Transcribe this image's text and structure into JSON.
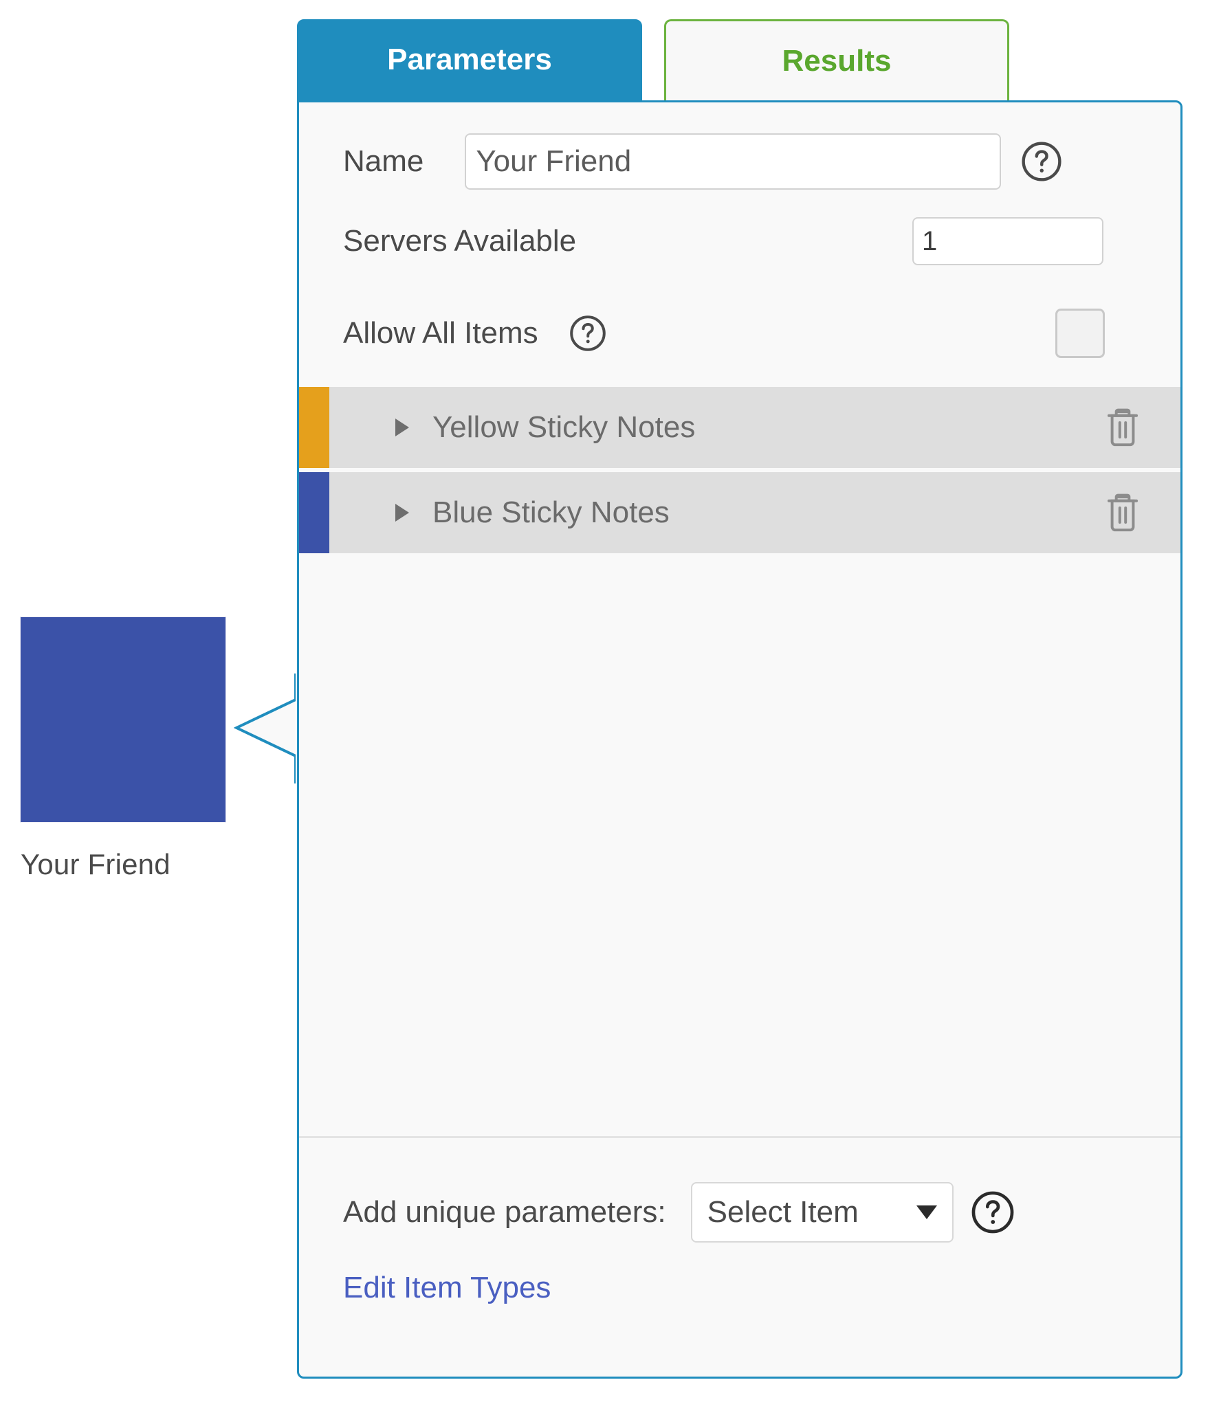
{
  "canvas": {
    "node": {
      "label": "Your Friend",
      "color": "#3b52a8"
    }
  },
  "tabs": [
    {
      "label": "Parameters",
      "active": true,
      "color": "#1f8dbe"
    },
    {
      "label": "Results",
      "active": false,
      "color": "#6cb33f"
    }
  ],
  "panel": {
    "border_color": "#1f8dbe",
    "fields": {
      "name": {
        "label": "Name",
        "value": "Your Friend",
        "placeholder": "Name",
        "help": "?"
      },
      "servers_available": {
        "label": "Servers Available",
        "value": "1",
        "placeholder": ""
      },
      "allow_all_items": {
        "label": "Allow All Items",
        "checked": false,
        "help": "?"
      }
    },
    "items": [
      {
        "name": "Yellow Sticky Notes",
        "color": "#e5a01c",
        "expanded": false
      },
      {
        "name": "Blue Sticky Notes",
        "color": "#3b52a8",
        "expanded": false
      }
    ],
    "footer": {
      "add_label": "Add unique parameters:",
      "select_value": "Select Item",
      "select_help": "?",
      "edit_link": "Edit Item Types"
    }
  }
}
